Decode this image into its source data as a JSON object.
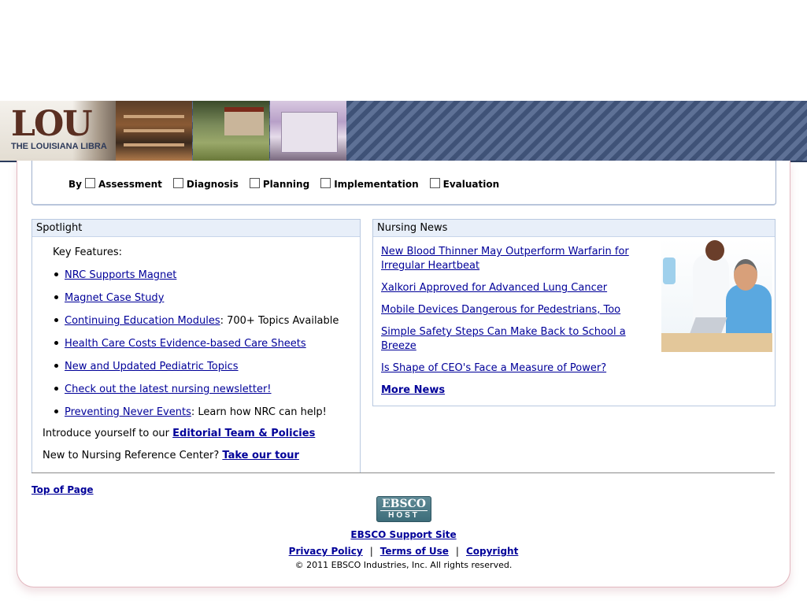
{
  "banner": {
    "logo_text": "LOU",
    "logo_subtitle": "THE LOUISIANA LIBRA"
  },
  "filters": {
    "by_label": "By",
    "options": [
      "Assessment",
      "Diagnosis",
      "Planning",
      "Implementation",
      "Evaluation"
    ]
  },
  "spotlight": {
    "title": "Spotlight",
    "key_features_label": "Key Features:",
    "items": [
      {
        "link": "NRC Supports Magnet",
        "suffix": ""
      },
      {
        "link": "Magnet Case Study",
        "suffix": ""
      },
      {
        "link": "Continuing Education Modules",
        "suffix": ": 700+ Topics Available"
      },
      {
        "link": "Health Care Costs Evidence-based Care Sheets",
        "suffix": ""
      },
      {
        "link": "New and Updated Pediatric Topics",
        "suffix": ""
      },
      {
        "link": "Check out the latest nursing newsletter!",
        "suffix": ""
      },
      {
        "link": "Preventing Never Events",
        "suffix": ": Learn how NRC can help!"
      }
    ],
    "editorial_prefix": "Introduce yourself to our ",
    "editorial_link": "Editorial Team & Policies",
    "tour_prefix": "New to Nursing Reference Center? ",
    "tour_link": "Take our tour"
  },
  "news": {
    "title": "Nursing News",
    "items": [
      "New Blood Thinner May Outperform Warfarin for Irregular Heartbeat",
      "Xalkori Approved for Advanced Lung Cancer",
      "Mobile Devices Dangerous for Pedestrians, Too",
      "Simple Safety Steps Can Make Back to School a Breeze",
      "Is Shape of CEO's Face a Measure of Power?"
    ],
    "more_label": "More News"
  },
  "footer": {
    "top_of_page": "Top of Page",
    "ebsco_line1": "EBSCO",
    "ebsco_line2": "HOST",
    "support": "EBSCO Support Site",
    "privacy": "Privacy Policy",
    "terms": "Terms of Use",
    "copyright_link": "Copyright",
    "separator": "|",
    "copyright_text": "© 2011 EBSCO Industries, Inc. All rights reserved."
  }
}
